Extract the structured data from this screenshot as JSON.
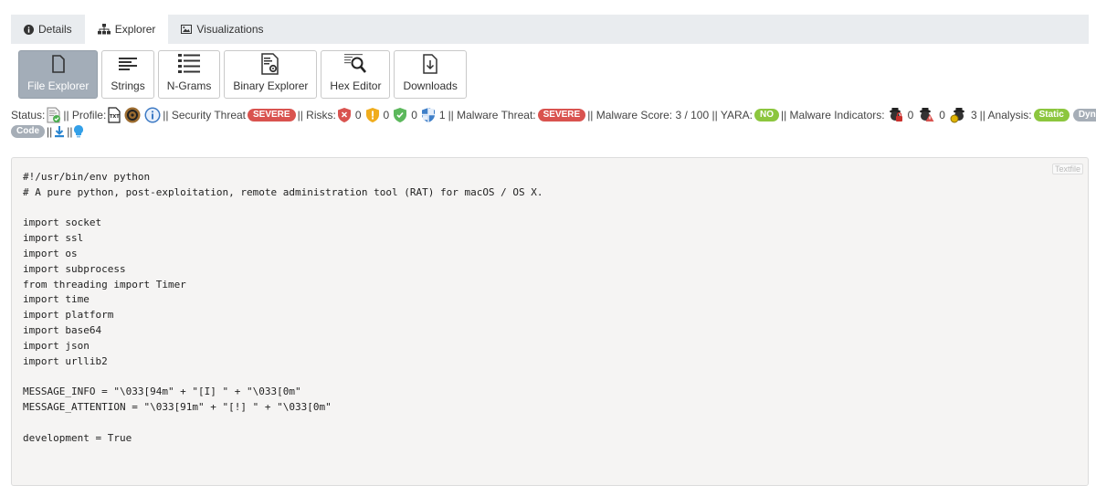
{
  "tabs": [
    {
      "label": "Details",
      "icon": "info-circle-icon"
    },
    {
      "label": "Explorer",
      "icon": "sitemap-icon",
      "active": true
    },
    {
      "label": "Visualizations",
      "icon": "image-icon"
    }
  ],
  "toolbar": {
    "file_explorer": "File Explorer",
    "strings": "Strings",
    "ngrams": "N-Grams",
    "binary_explorer": "Binary Explorer",
    "hex_editor": "Hex Editor",
    "downloads": "Downloads"
  },
  "status": {
    "status_label": "Status:",
    "profile_label": "|| Profile:",
    "security_threat_label": "|| Security Threat",
    "security_threat_value": "SEVERE",
    "risks_label": "|| Risks:",
    "risk_counts": [
      "0",
      "0",
      "0",
      "1"
    ],
    "malware_threat_label": "|| Malware Threat:",
    "malware_threat_value": "SEVERE",
    "malware_score": "|| Malware Score: 3 / 100 || YARA:",
    "yara_value": "NO",
    "indicators_label": "|| Malware Indicators:",
    "indicator_counts": [
      "0",
      "0",
      "3"
    ],
    "analysis_label": "|| Analysis:",
    "analysis_static": "Static",
    "analysis_dynamic": "Dynamic",
    "analysis_code": "Code",
    "sep": "||",
    "colors": {
      "severe": "#d9534f",
      "green": "#8cc63e",
      "grey": "#a6aeb7"
    }
  },
  "code_panel": {
    "textfile_button": "Textfile",
    "content": "#!/usr/bin/env python\n# A pure python, post-exploitation, remote administration tool (RAT) for macOS / OS X.\n\nimport socket\nimport ssl\nimport os\nimport subprocess\nfrom threading import Timer\nimport time\nimport platform\nimport base64\nimport json\nimport urllib2\n\nMESSAGE_INFO = \"\\033[94m\" + \"[I] \" + \"\\033[0m\"\nMESSAGE_ATTENTION = \"\\033[91m\" + \"[!] \" + \"\\033[0m\"\n\ndevelopment = True"
  }
}
